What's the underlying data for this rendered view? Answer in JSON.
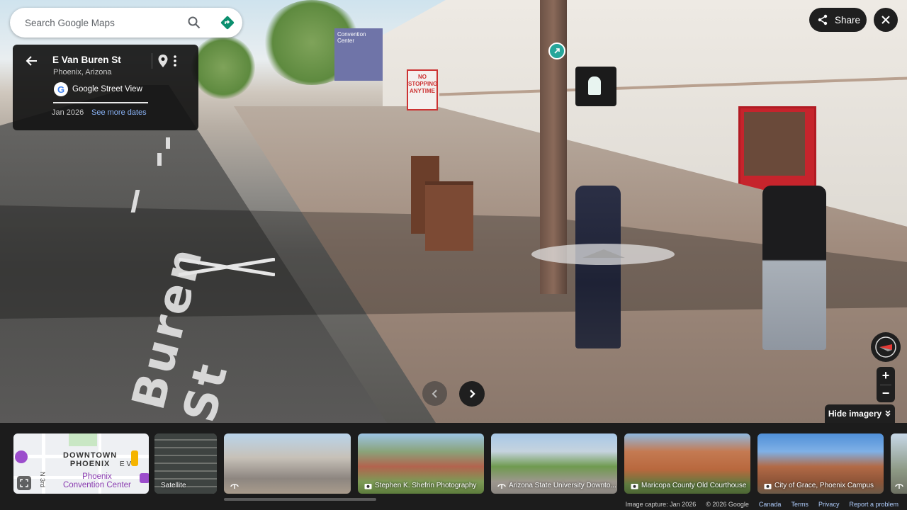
{
  "search": {
    "placeholder": "Search Google Maps"
  },
  "card": {
    "title": "E Van Buren St",
    "subtitle": "Phoenix, Arizona",
    "provider": "Google Street View",
    "date": "Jan 2026",
    "more_dates": "See more dates"
  },
  "top_right": {
    "share_label": "Share"
  },
  "scene": {
    "street_text": "Buren St",
    "sign_no": "NO STOPPING ANYTIME",
    "sign_blue": "Convention Center"
  },
  "controls": {
    "hide_imagery": "Hide imagery",
    "zoom_in": "+",
    "zoom_out": "−"
  },
  "filmstrip": {
    "map": {
      "label_line1": "DOWNTOWN",
      "label_line2": "PHOENIX",
      "street": "E V",
      "street2": "N 3rd",
      "poi": "Phoenix",
      "poi2": "Convention Center"
    },
    "satellite": "Satellite",
    "thumbs": [
      {
        "label": "",
        "kind": "streetview"
      },
      {
        "label": "Stephen K. Shefrin Photography",
        "kind": "photo"
      },
      {
        "label": "Arizona State University Downto...",
        "kind": "streetview"
      },
      {
        "label": "Maricopa County Old Courthouse",
        "kind": "photo"
      },
      {
        "label": "City of Grace, Phoenix Campus",
        "kind": "photo"
      }
    ]
  },
  "footer": {
    "capture": "Image capture: Jan 2026",
    "copyright": "© 2026 Google",
    "links": [
      "Canada",
      "Terms",
      "Privacy",
      "Report a problem"
    ]
  },
  "colors": {
    "accent_blue": "#8ab4f8",
    "teal": "#26a69a",
    "dark_ui": "#1f1f1f",
    "poster_red": "#c6242c"
  }
}
